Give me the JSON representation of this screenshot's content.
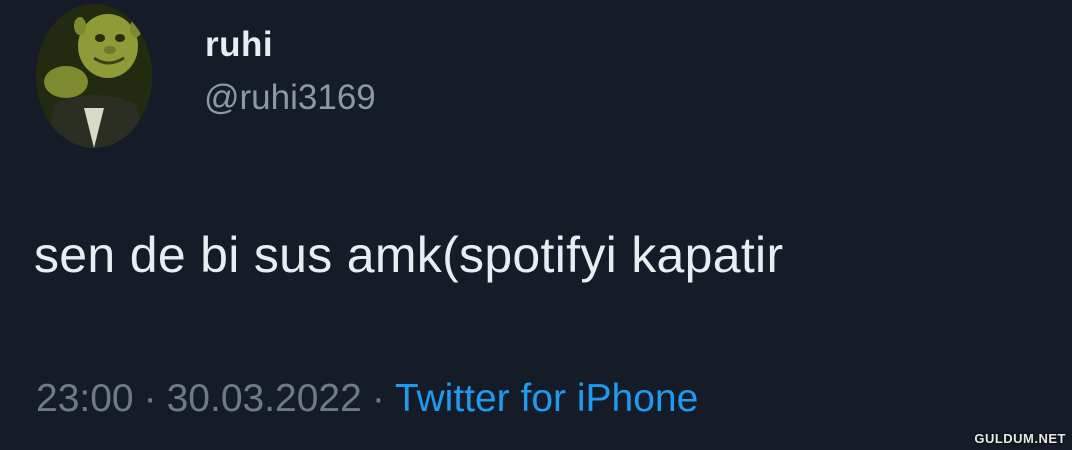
{
  "tweet": {
    "author": {
      "display_name": "ruhi",
      "handle": "@ruhi3169",
      "avatar_icon": "shrek-avatar-icon"
    },
    "text": "sen de bi sus amk(spotifyi kapatir",
    "time": "23:00",
    "date": "30.03.2022",
    "separator": "·",
    "source": "Twitter for iPhone"
  },
  "watermark": "GULDUM.NET",
  "colors": {
    "background": "#151c27",
    "primary_text": "#e9edf1",
    "secondary_text": "#8b98a5",
    "link": "#1d9bf0"
  }
}
